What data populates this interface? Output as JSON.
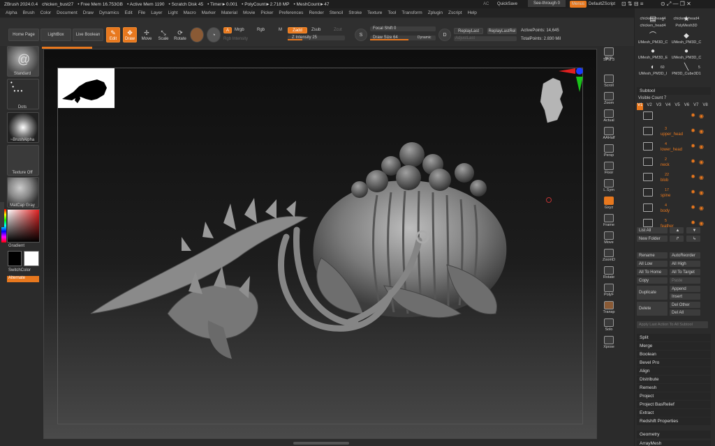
{
  "titlebar": {
    "app": "ZBrush 2024.0.4",
    "file": "chicken_bust27",
    "free_mem": "• Free Mem 16.753GB",
    "active_mem": "• Active Mem 1190",
    "scratch": "• Scratch Disk 45",
    "timer": "• Timer►0.001",
    "polycount": "• PolyCount►2.718 MP",
    "meshcount": "• MeshCount►47",
    "ac": "AC",
    "quicksave": "QuickSave",
    "see_through": "See-through  0",
    "menus": "Menus",
    "script": "DefaultZScript"
  },
  "menubar": [
    "Alpha",
    "Brush",
    "Color",
    "Document",
    "Draw",
    "Dynamics",
    "Edit",
    "File",
    "Layer",
    "Light",
    "Macro",
    "Marker",
    "Material",
    "Movie",
    "Picker",
    "Preferences",
    "Render",
    "Stencil",
    "Stroke",
    "Texture",
    "Tool",
    "Transform",
    "Zplugin",
    "Zscript",
    "Help"
  ],
  "shelf": {
    "home_page": "Home Page",
    "lightbox": "LightBox",
    "live_boolean": "Live Boolean",
    "edit": "Edit",
    "draw": "Draw",
    "move": "Move",
    "scale": "Scale",
    "rotate": "Rotate",
    "a": "A",
    "mrgb": "Mrgb",
    "rgb": "Rgb",
    "m": "M",
    "zadd": "Zadd",
    "zsub": "Zsub",
    "zcut": "Zcut",
    "rgb_intensity": "Rgb Intensity",
    "z_intensity": "Z Intensity 25",
    "z_intensity_value": 25,
    "focal_shift": "Focal Shift 0",
    "draw_size": "Draw Size 64",
    "draw_size_value": 64,
    "dynamic": "Dynamic",
    "replay_last": "ReplayLast",
    "replay_last_rel": "ReplayLastRel",
    "adjust_last": "AdjustLast",
    "active_points": "ActivePoints: 14,645",
    "total_points": "TotalPoints: 2.830 Mil"
  },
  "left": {
    "standard": "Standard",
    "dots": "Dots",
    "brushalpha": "~BrushAlpha",
    "texture": "Texture Off",
    "matcap": "MatCap Gray",
    "gradient": "Gradient",
    "switchcolor": "SwitchColor",
    "alternate": "Alternate"
  },
  "rightcol": [
    "BPR",
    "SPix 3",
    "Scroll",
    "Zoom",
    "Actual",
    "AAHalf",
    "Persp",
    "Floor",
    "L.Sym",
    "Gxyz",
    "Frame",
    "Move",
    "ZoomD",
    "Rotate",
    "PolyF",
    "Transp",
    "Solo",
    "Xpose"
  ],
  "tools": {
    "row1": [
      "chicken_head4",
      "chicken_head4"
    ],
    "row2_counts": [
      "3",
      ""
    ],
    "row2": [
      "chicken_head4",
      "PolyMesh3D"
    ],
    "row3": [
      "UMesh_PM3D_C",
      "UMesh_PM3D_C"
    ],
    "row4": [
      "UMesh_PM3D_E",
      "UMesh_PM3D_C"
    ],
    "row5_counts": [
      "60",
      "5"
    ],
    "row5": [
      "UMesh_PM3D_I",
      "PM3D_Cube3D1"
    ]
  },
  "subtool": {
    "header": "Subtool",
    "visible_count": "Visible Count 7",
    "versions": [
      "V1",
      "V2",
      "V3",
      "V4",
      "V5",
      "V6",
      "V7",
      "V8"
    ],
    "items": [
      {
        "name": "",
        "count": ""
      },
      {
        "name": "upper_head",
        "count": "3"
      },
      {
        "name": "lower_head",
        "count": "4"
      },
      {
        "name": "neck",
        "count": "2"
      },
      {
        "name": "blob",
        "count": "22"
      },
      {
        "name": "spine",
        "count": "17"
      },
      {
        "name": "body",
        "count": "4"
      },
      {
        "name": "feather",
        "count": "5"
      }
    ],
    "list_all": "List All",
    "new_folder": "New Folder",
    "rename": "Rename",
    "autoreorder": "AutoReorder",
    "all_low": "All Low",
    "all_high": "All High",
    "all_to_home": "All To Home",
    "all_to_target": "All To Target",
    "copy": "Copy",
    "paste": "Paste",
    "duplicate": "Duplicate",
    "append": "Append",
    "insert": "Insert",
    "delete": "Delete",
    "del_other": "Del Other",
    "del_all": "Del All",
    "apply_last": "Apply Last Action To All Subtool",
    "sections": [
      "Split",
      "Merge",
      "Boolean",
      "Bevel Pro",
      "Align",
      "Distribute",
      "Remesh",
      "Project",
      "Project BasRelief",
      "Extract",
      "Redshift Properties"
    ],
    "geometry": "Geometry",
    "arraymesh": "ArrayMesh"
  },
  "colors": {
    "accent": "#e8781e",
    "bg": "#2b2b2b"
  }
}
